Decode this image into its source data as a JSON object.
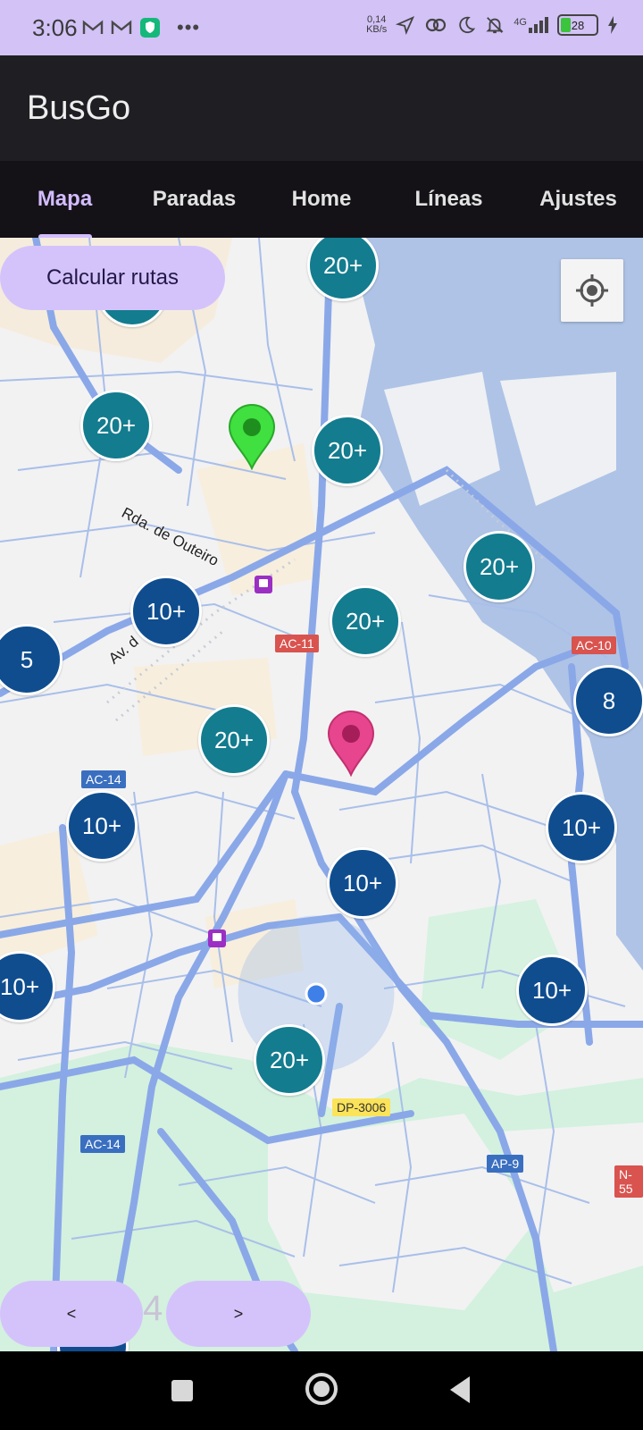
{
  "status_bar": {
    "time": "3:06",
    "net_speed_value": "0,14",
    "net_speed_unit": "KB/s",
    "network": "4G",
    "battery": "28"
  },
  "app": {
    "title": "BusGo"
  },
  "tabs": [
    {
      "label": "Mapa",
      "active": true
    },
    {
      "label": "Paradas",
      "active": false
    },
    {
      "label": "Home",
      "active": false
    },
    {
      "label": "Líneas",
      "active": false
    },
    {
      "label": "Ajustes",
      "active": false
    }
  ],
  "map": {
    "calc_routes_label": "Calcular rutas",
    "street_names": [
      "Rda. de Outeiro",
      "Av. d"
    ],
    "road_labels": [
      "AC-11",
      "AC-10",
      "AC-14",
      "AC-14",
      "DP-3006",
      "AP-9",
      "N-55"
    ],
    "clusters": [
      {
        "label": "20+",
        "color": "#137c8f"
      },
      {
        "label": "20+",
        "color": "#137c8f"
      },
      {
        "label": "20+",
        "color": "#137c8f"
      },
      {
        "label": "20+",
        "color": "#137c8f"
      },
      {
        "label": "20+",
        "color": "#137c8f"
      },
      {
        "label": "10+",
        "color": "#0f4d8f"
      },
      {
        "label": "5",
        "color": "#0f4d8f"
      },
      {
        "label": "8",
        "color": "#0f4d8f"
      },
      {
        "label": "20+",
        "color": "#137c8f"
      },
      {
        "label": "10+",
        "color": "#0f4d8f"
      },
      {
        "label": "10+",
        "color": "#0f4d8f"
      },
      {
        "label": "10+",
        "color": "#0f4d8f"
      },
      {
        "label": "10+",
        "color": "#0f4d8f"
      },
      {
        "label": "10+",
        "color": "#0f4d8f"
      },
      {
        "label": "20+",
        "color": "#137c8f"
      }
    ],
    "origin_marker_color": "#3fe03f",
    "destination_marker_color": "#e8458f"
  },
  "pagination": {
    "prev_label": "<",
    "next_label": ">",
    "page": "4"
  }
}
